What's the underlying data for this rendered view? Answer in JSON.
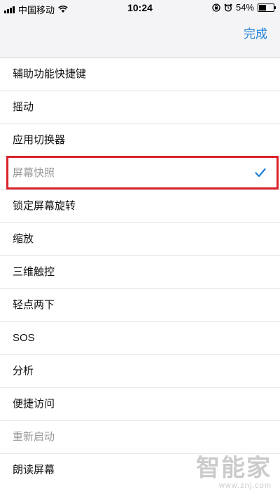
{
  "status_bar": {
    "carrier": "中国移动",
    "time": "10:24",
    "battery": "54%",
    "battery_level": 0.54,
    "icons": [
      "signal-icon",
      "wifi-icon",
      "orientation-lock-icon",
      "alarm-icon",
      "battery-icon"
    ]
  },
  "nav": {
    "done_label": "完成"
  },
  "items": [
    {
      "label": "辅助功能快捷键"
    },
    {
      "label": "摇动"
    },
    {
      "label": "应用切换器"
    },
    {
      "label": "屏幕快照",
      "selected": true
    },
    {
      "label": "锁定屏幕旋转"
    },
    {
      "label": "缩放"
    },
    {
      "label": "三维触控"
    },
    {
      "label": "轻点两下"
    },
    {
      "label": "SOS"
    },
    {
      "label": "分析"
    },
    {
      "label": "便捷访问"
    },
    {
      "label": "重新启动",
      "disabled": true
    },
    {
      "label": "朗读屏幕"
    }
  ],
  "colors": {
    "accent": "#1e7fd6",
    "highlight": "#d9232a"
  },
  "watermark": {
    "logo": "智能家",
    "url": "www.znj.com"
  }
}
